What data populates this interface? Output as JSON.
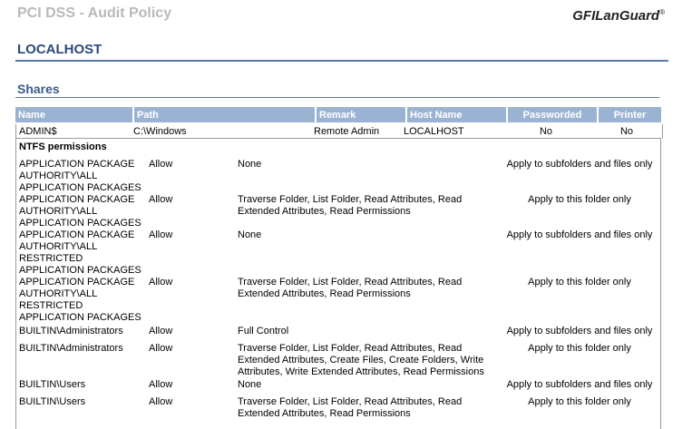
{
  "header": {
    "title": "PCI DSS - Audit Policy",
    "logo": "GFI LanGuard",
    "logo_gfi": "GFI",
    "logo_lg": "LanGuard",
    "logo_tm": "®"
  },
  "host": "LOCALHOST",
  "section": "Shares",
  "table": {
    "headers": [
      "Name",
      "Path",
      "Remark",
      "Host Name",
      "Passworded",
      "Printer"
    ],
    "row": [
      "ADMIN$",
      "C:\\Windows",
      "Remote Admin",
      "LOCALHOST",
      "No",
      "No"
    ]
  },
  "ntfs": {
    "title": "NTFS permissions",
    "rows": [
      {
        "account": "APPLICATION PACKAGE AUTHORITY\\ALL APPLICATION PACKAGES",
        "access": "Allow",
        "rights": "None",
        "scope": "Apply to subfolders and files only"
      },
      {
        "account": "APPLICATION PACKAGE AUTHORITY\\ALL APPLICATION PACKAGES",
        "access": "Allow",
        "rights": "Traverse Folder, List Folder, Read Attributes, Read Extended Attributes, Read Permissions",
        "scope": "Apply to this folder only"
      },
      {
        "account": "APPLICATION PACKAGE AUTHORITY\\ALL RESTRICTED APPLICATION PACKAGES",
        "access": "Allow",
        "rights": "None",
        "scope": "Apply to subfolders and files only"
      },
      {
        "account": "APPLICATION PACKAGE AUTHORITY\\ALL RESTRICTED APPLICATION PACKAGES",
        "access": "Allow",
        "rights": "Traverse Folder, List Folder, Read Attributes, Read Extended Attributes, Read Permissions",
        "scope": "Apply to this folder only"
      },
      {
        "account": "BUILTIN\\Administrators",
        "access": "Allow",
        "rights": "Full Control",
        "scope": "Apply to subfolders and files only"
      },
      {
        "account": "BUILTIN\\Administrators",
        "access": "Allow",
        "rights": "Traverse Folder, List Folder, Read Attributes, Read Extended Attributes, Create Files, Create Folders, Write Attributes, Write Extended Attributes, Read Permissions",
        "scope": "Apply to this folder only"
      },
      {
        "account": "BUILTIN\\Users",
        "access": "Allow",
        "rights": "None",
        "scope": "Apply to subfolders and files only"
      },
      {
        "account": "BUILTIN\\Users",
        "access": "Allow",
        "rights": "Traverse Folder, List Folder, Read Attributes, Read Extended Attributes, Read Permissions",
        "scope": "Apply to this folder only"
      }
    ]
  },
  "colors": {
    "accent": "#2b4a7c",
    "header_bg": "#9bb3d3",
    "title_gray": "#b9b9b9"
  }
}
